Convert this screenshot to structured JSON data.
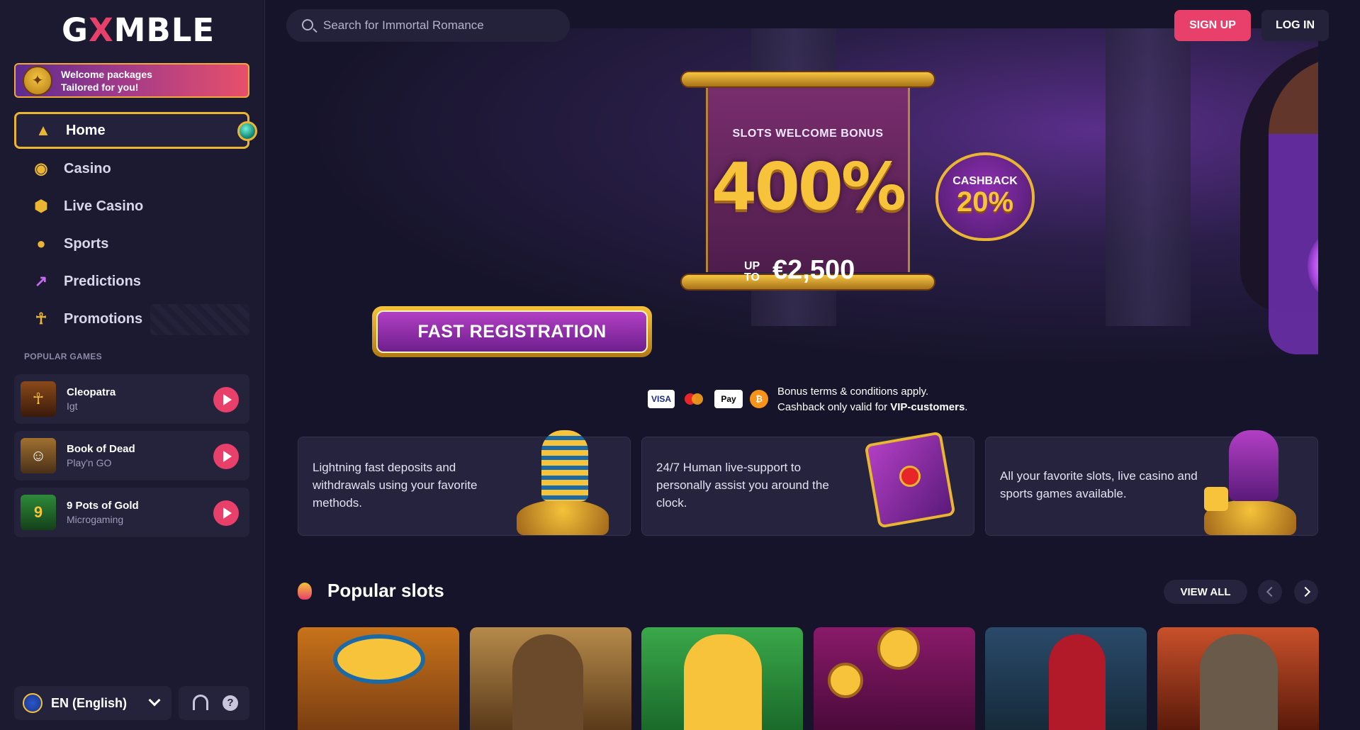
{
  "brand": {
    "logo_left": "G",
    "logo_x": "X",
    "logo_right": "MBLE"
  },
  "welcome": {
    "line1": "Welcome packages",
    "line2": "Tailored for you!"
  },
  "nav": [
    {
      "label": "Home",
      "icon": "pyramid-icon",
      "active": true
    },
    {
      "label": "Casino",
      "icon": "chip-icon"
    },
    {
      "label": "Live Casino",
      "icon": "dice-icon"
    },
    {
      "label": "Sports",
      "icon": "ball-icon"
    },
    {
      "label": "Predictions",
      "icon": "trend-icon"
    },
    {
      "label": "Promotions",
      "icon": "ankh-icon"
    }
  ],
  "popular_games_label": "POPULAR GAMES",
  "popular_games": [
    {
      "name": "Cleopatra",
      "provider": "Igt"
    },
    {
      "name": "Book of Dead",
      "provider": "Play'n GO"
    },
    {
      "name": "9 Pots of Gold",
      "provider": "Microgaming"
    }
  ],
  "footer": {
    "language": "EN (English)",
    "help": "?"
  },
  "search": {
    "placeholder": "Search for Immortal Romance"
  },
  "header": {
    "signup": "SIGN UP",
    "login": "LOG IN"
  },
  "hero": {
    "subtitle": "SLOTS WELCOME BONUS",
    "percent": "400%",
    "upto_line1": "UP",
    "upto_line2": "TO",
    "amount": "€2,500",
    "cashback_label": "CASHBACK",
    "cashback_value": "20%",
    "cta": "FAST REGISTRATION"
  },
  "payments": {
    "visa": "VISA",
    "applepay": "Pay",
    "btc": "₿"
  },
  "terms": {
    "line1": "Bonus terms & conditions apply.",
    "line2_prefix": "Cashback only valid for ",
    "line2_bold": "VIP-customers",
    "line2_suffix": "."
  },
  "features": [
    {
      "text": "Lightning fast deposits and withdrawals using your favorite methods."
    },
    {
      "text": "24/7 Human live-support to personally assist you around the clock."
    },
    {
      "text": "All your favorite slots, live casino and sports games available."
    }
  ],
  "popular_slots": {
    "title": "Popular slots",
    "view_all": "VIEW ALL"
  },
  "colors": {
    "accent": "#e8406a",
    "gold": "#e9b532",
    "bg": "#16142a",
    "panel": "#25223b"
  }
}
